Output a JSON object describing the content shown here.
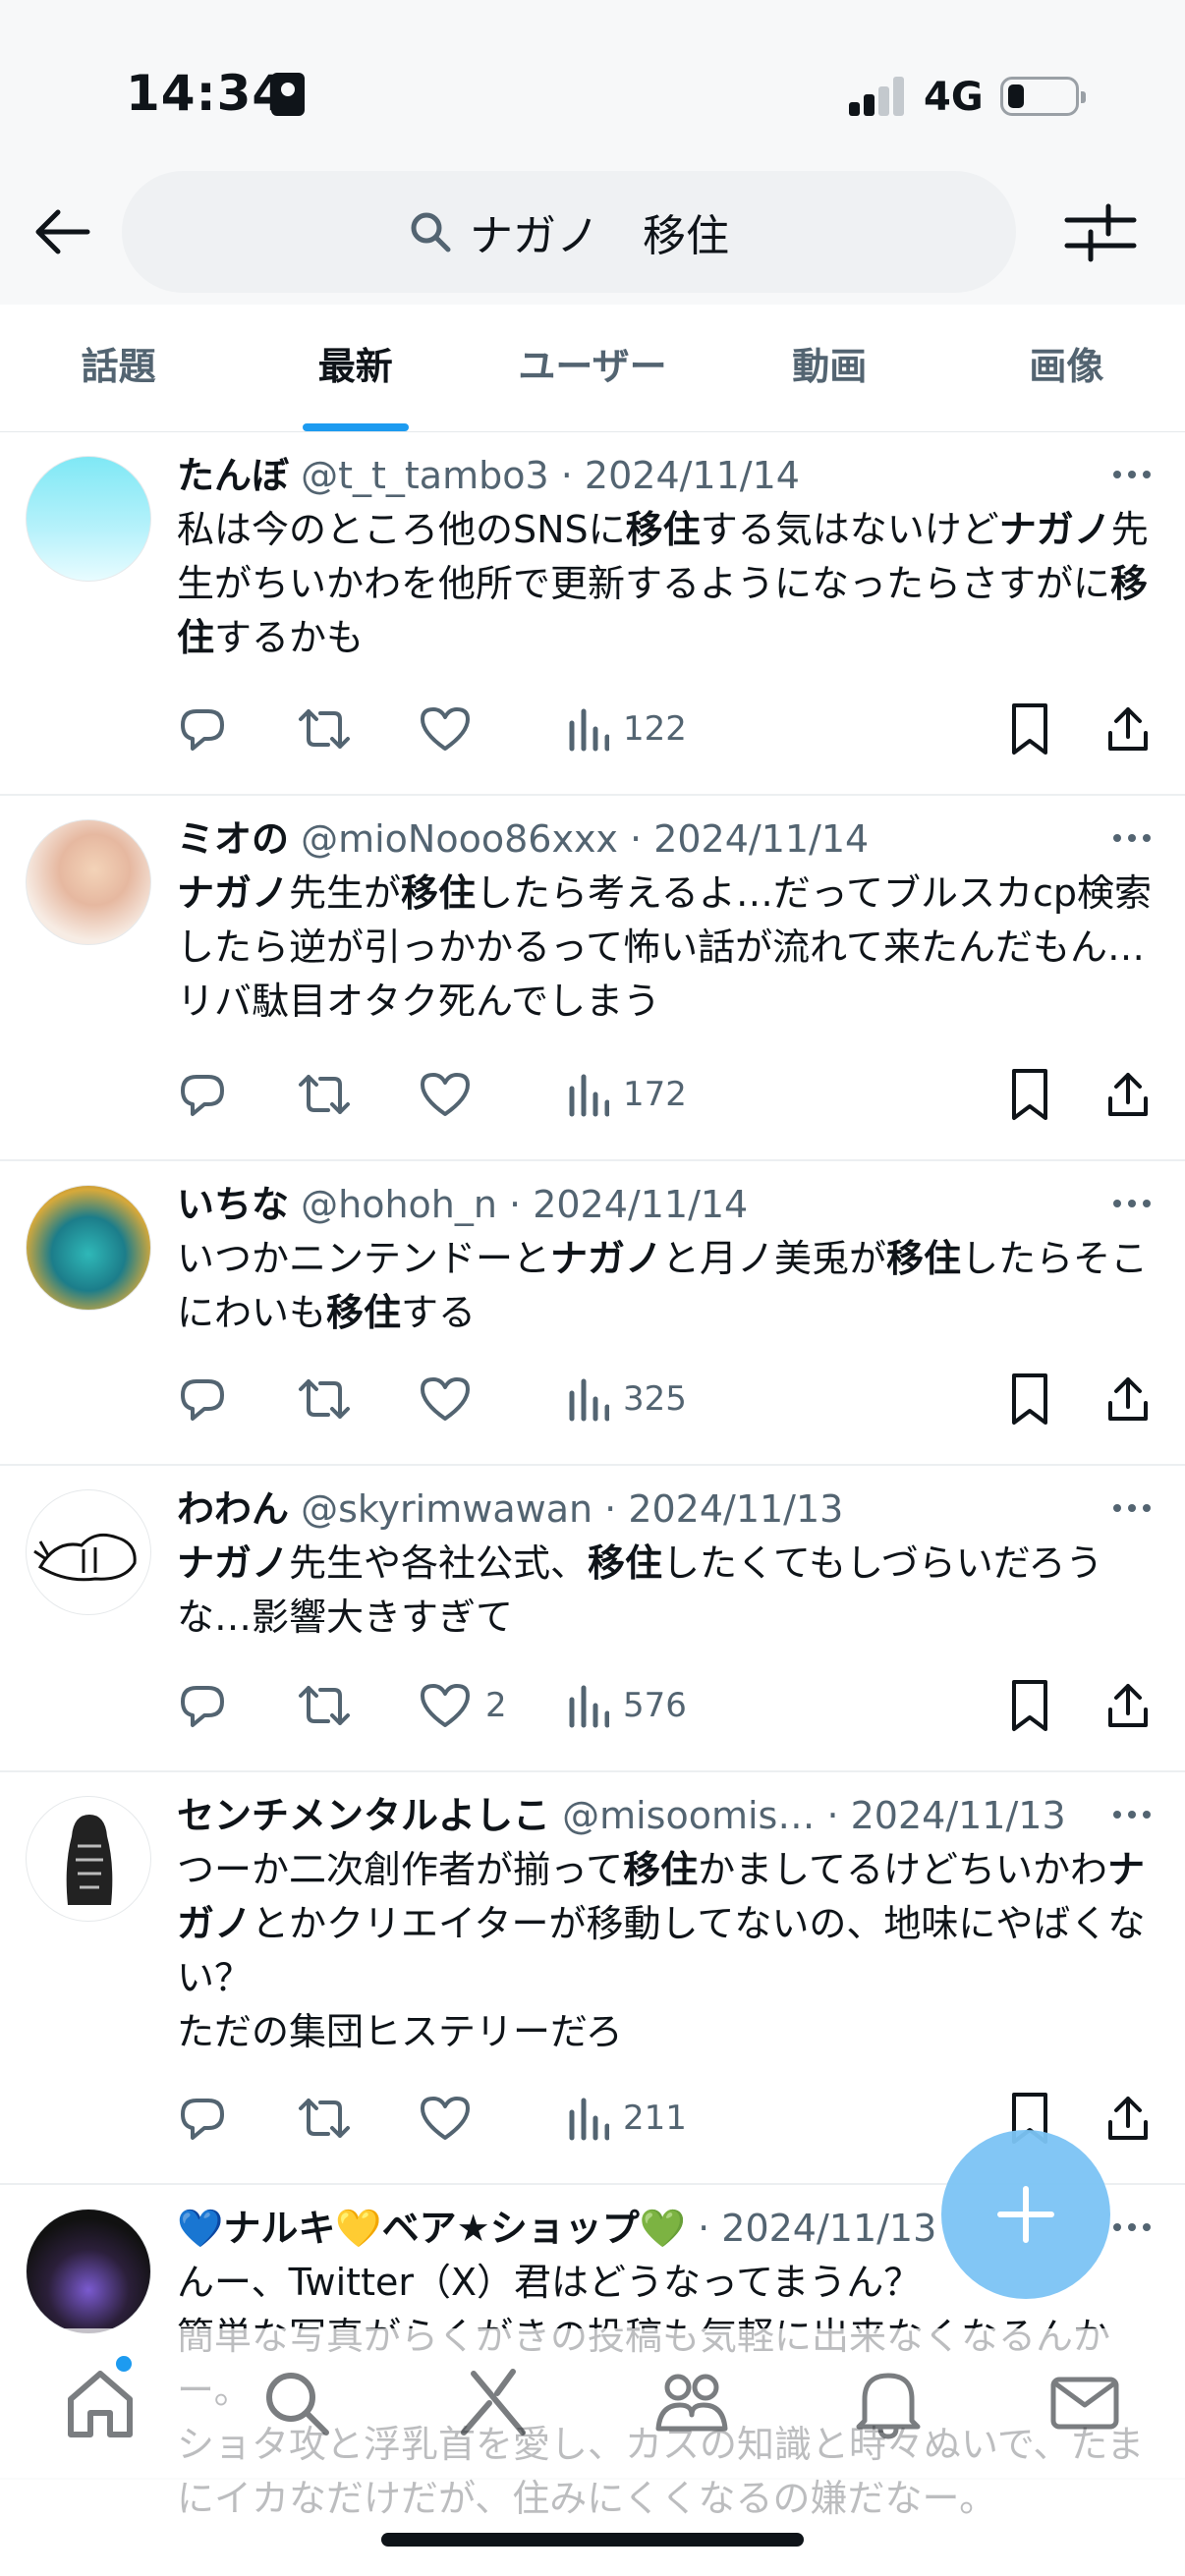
{
  "status_bar": {
    "time": "14:34",
    "network": "4G"
  },
  "search": {
    "query": "ナガノ　移住"
  },
  "tabs": [
    {
      "label": "話題",
      "active": false
    },
    {
      "label": "最新",
      "active": true
    },
    {
      "label": "ユーザー",
      "active": false
    },
    {
      "label": "動画",
      "active": false
    },
    {
      "label": "画像",
      "active": false
    }
  ],
  "tweets": [
    {
      "name": "たんぼ",
      "handle": "@t_t_tambo3",
      "date": "2024/11/14",
      "segments": [
        {
          "t": "私は今のところ他のSNSに"
        },
        {
          "t": "移住",
          "b": true
        },
        {
          "t": "する気はないけど"
        },
        {
          "t": "ナガノ",
          "b": true
        },
        {
          "t": "先生がちいかわを他所で更新するようになったらさすがに"
        },
        {
          "t": "移住",
          "b": true
        },
        {
          "t": "するかも"
        }
      ],
      "likes": "",
      "views": "122"
    },
    {
      "name": "ミオの",
      "handle": "@mioNooo86xxx",
      "date": "2024/11/14",
      "segments": [
        {
          "t": "ナガノ",
          "b": true
        },
        {
          "t": "先生が"
        },
        {
          "t": "移住",
          "b": true
        },
        {
          "t": "したら考えるよ…だってブルスカcp検索したら逆が引っかかるって怖い話が流れて来たんだもん…リバ駄目オタク死んでしまう"
        }
      ],
      "likes": "",
      "views": "172"
    },
    {
      "name": "いちな",
      "handle": "@hohoh_n",
      "date": "2024/11/14",
      "segments": [
        {
          "t": "いつかニンテンドーと"
        },
        {
          "t": "ナガノ",
          "b": true
        },
        {
          "t": "と月ノ美兎が"
        },
        {
          "t": "移住",
          "b": true
        },
        {
          "t": "したらそこにわいも"
        },
        {
          "t": "移住",
          "b": true
        },
        {
          "t": "する"
        }
      ],
      "likes": "",
      "views": "325"
    },
    {
      "name": "わわん",
      "handle": "@skyrimwawan",
      "date": "2024/11/13",
      "segments": [
        {
          "t": "ナガノ",
          "b": true
        },
        {
          "t": "先生や各社公式、"
        },
        {
          "t": "移住",
          "b": true
        },
        {
          "t": "したくてもしづらいだろうな…影響大きすぎて"
        }
      ],
      "likes": "2",
      "views": "576"
    },
    {
      "name": "センチメンタルよしこ",
      "handle": "@misoomis…",
      "date": "2024/11/13",
      "segments": [
        {
          "t": "つーか二次創作者が揃って"
        },
        {
          "t": "移住",
          "b": true
        },
        {
          "t": "かましてるけどちいかわ"
        },
        {
          "t": "ナガノ",
          "b": true
        },
        {
          "t": "とかクリエイターが移動してないの、地味にやばくない？\nただの集団ヒステリーだろ"
        }
      ],
      "likes": "",
      "views": "211"
    },
    {
      "name": "💙ナルキ💛ベア★ショップ💚",
      "handle": "",
      "date": "2024/11/13",
      "segments": [
        {
          "t": "んー、Twitter（X）君はどうなってまうん？\n簡単な写真がらくがきの投稿も気軽に出来なくなるんかー。\nショタ攻と浮乳首を愛し、カスの知識と時々ぬいで、たまにイカなだけだが、住みにくくなるの嫌だなー。"
        }
      ],
      "likes": "",
      "views": ""
    }
  ],
  "colors": {
    "accent": "#1d9bf0",
    "text": "#0f1419",
    "muted": "#536471"
  },
  "icons": {
    "reply": "reply-icon",
    "retweet": "retweet-icon",
    "like": "like-icon",
    "views": "views-icon",
    "bookmark": "bookmark-icon",
    "share": "share-icon",
    "compose": "plus-icon"
  },
  "bottom_nav": [
    "home-icon",
    "search-icon",
    "grok-icon",
    "communities-icon",
    "notifications-icon",
    "messages-icon"
  ]
}
